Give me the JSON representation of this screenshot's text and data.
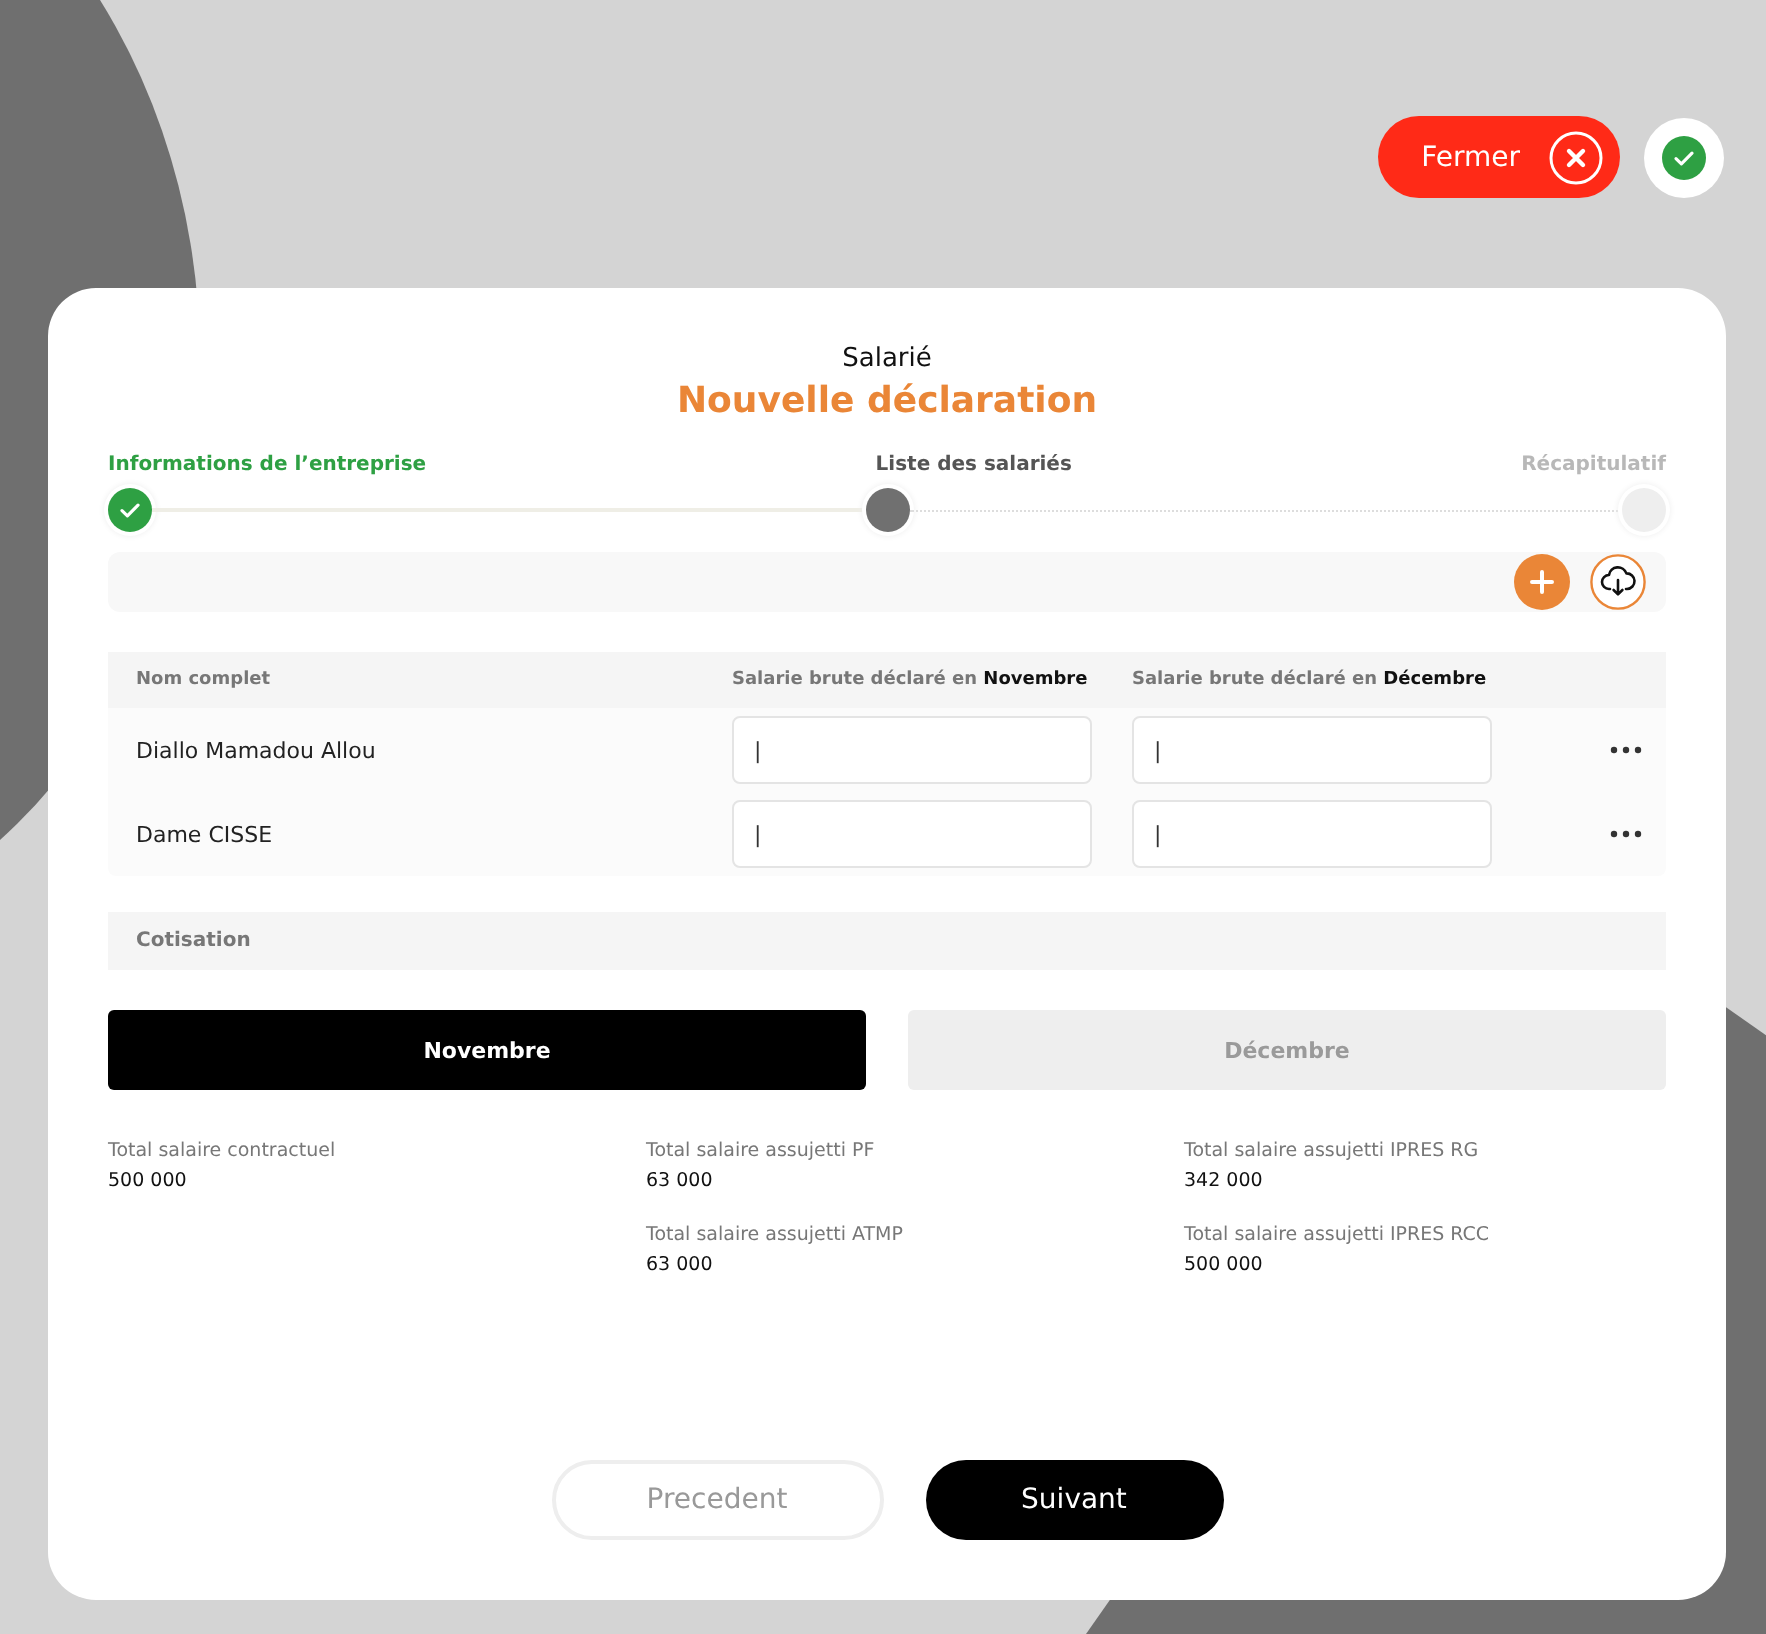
{
  "header_actions": {
    "close_label": "Fermer",
    "confirm": true
  },
  "subtitle": "Salarié",
  "title": "Nouvelle déclaration",
  "steps": [
    {
      "label": "Informations de l’entreprise",
      "completed": true,
      "current": false
    },
    {
      "label": "Liste des salariés",
      "completed": false,
      "current": true
    },
    {
      "label": "Récapitulatif",
      "completed": false,
      "current": false
    }
  ],
  "table": {
    "columns": [
      "Nom complet",
      "Salarie brute déclaré en **Novembre**",
      "Salarie brute déclaré en **Décembre**"
    ],
    "rows": [
      {
        "name": "Diallo Mamadou Allou",
        "november": "|",
        "december": "|"
      },
      {
        "name": "Dame CISSE",
        "november": "|",
        "december": "|"
      }
    ]
  },
  "section_label": "Cotisation",
  "tabs": [
    {
      "label": "Novembre",
      "selected": true
    },
    {
      "label": "Décembre",
      "selected": false
    }
  ],
  "totals_columns": [
    [
      {
        "label": "Total salaire contractuel",
        "value": "500 000"
      }
    ],
    [
      {
        "label": "Total salaire assujetti PF",
        "value": "63 000"
      },
      {
        "label": "Total salaire assujetti ATMP",
        "value": "63 000"
      }
    ],
    [
      {
        "label": "Total salaire assujetti IPRES RG",
        "value": "342 000"
      },
      {
        "label": "Total salaire assujetti IPRES RCC",
        "value": "500 000"
      }
    ]
  ],
  "footer_buttons": [
    {
      "label": "Precedent",
      "kind": "secondary"
    },
    {
      "label": "Suivant",
      "kind": "primary"
    }
  ]
}
